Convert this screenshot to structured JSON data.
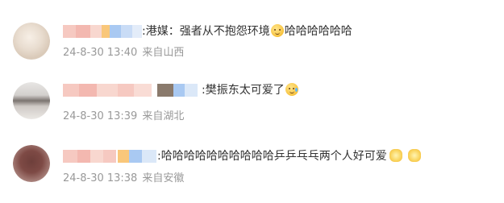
{
  "comments": [
    {
      "text": ":港媒：强者从不抱怨环境",
      "text_after": "哈哈哈哈哈哈",
      "date": "24-8-30 13:40",
      "location": "来自山西",
      "emoji": "cat-face-icon"
    },
    {
      "text": ":樊振东太可爱了",
      "text_after": "",
      "date": "24-8-30 13:39",
      "location": "来自湖北",
      "emoji": "sweat-smile-icon"
    },
    {
      "text": ":哈哈哈哈哈哈哈哈哈哈乒乒乓乓两个人好可爱",
      "text_after": "",
      "date": "24-8-30 13:38",
      "location": "来自安徽",
      "emoji": "flower-icon"
    }
  ],
  "colors": {
    "text": "#333333",
    "meta": "#999999",
    "background": "#ffffff"
  }
}
